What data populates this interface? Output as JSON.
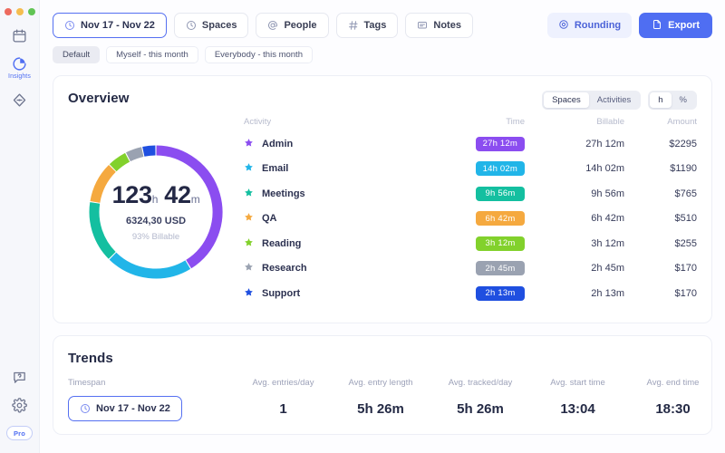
{
  "window": {
    "traffic_lights": [
      {
        "name": "close",
        "color": "#ed6a5e"
      },
      {
        "name": "minimize",
        "color": "#f5bd4f"
      },
      {
        "name": "zoom",
        "color": "#61c454"
      }
    ]
  },
  "sidebar": {
    "items": [
      {
        "name": "calendar",
        "icon": "calendar-icon",
        "label": ""
      },
      {
        "name": "insights",
        "icon": "insights-pie-icon",
        "label": "Insights"
      },
      {
        "name": "integrations",
        "icon": "diamond-icon",
        "label": ""
      }
    ],
    "bottom": [
      {
        "name": "help",
        "icon": "help-chat-icon",
        "label": ""
      },
      {
        "name": "settings",
        "icon": "gear-icon",
        "label": ""
      }
    ],
    "pro_badge": "Pro"
  },
  "toolbar": {
    "buttons": [
      {
        "label": "Nov 17 - Nov 22",
        "icon": "clock-icon",
        "active": true
      },
      {
        "label": "Spaces",
        "icon": "clock-icon",
        "active": false
      },
      {
        "label": "People",
        "icon": "at-icon",
        "active": false
      },
      {
        "label": "Tags",
        "icon": "hash-icon",
        "active": false
      },
      {
        "label": "Notes",
        "icon": "note-icon",
        "active": false
      }
    ],
    "rounding_label": "Rounding",
    "export_label": "Export",
    "accent_color": "#4f6ef2"
  },
  "filters": [
    {
      "label": "Default",
      "selected": true
    },
    {
      "label": "Myself - this month",
      "selected": false
    },
    {
      "label": "Everybody - this month",
      "selected": false
    }
  ],
  "overview": {
    "title": "Overview",
    "view_toggle": [
      {
        "label": "Spaces",
        "on": true
      },
      {
        "label": "Activities",
        "on": false
      }
    ],
    "unit_toggle": [
      {
        "label": "h",
        "on": true
      },
      {
        "label": "%",
        "on": false
      }
    ],
    "donut": {
      "hours": "123",
      "hours_unit": "h",
      "minutes": "42",
      "minutes_unit": "m",
      "amount": "6324,30 USD",
      "billable_note": "93% Billable"
    },
    "columns": {
      "activity": "Activity",
      "time": "Time",
      "billable": "Billable",
      "amount": "Amount"
    },
    "rows": [
      {
        "activity": "Admin",
        "time": "27h 12m",
        "billable": "27h 12m",
        "amount": "$2295",
        "color": "#8b4df0"
      },
      {
        "activity": "Email",
        "time": "14h 02m",
        "billable": "14h 02m",
        "amount": "$1190",
        "color": "#21b5e8"
      },
      {
        "activity": "Meetings",
        "time": "9h 56m",
        "billable": "9h 56m",
        "amount": "$765",
        "color": "#14bfa0"
      },
      {
        "activity": "QA",
        "time": "6h 42m",
        "billable": "6h 42m",
        "amount": "$510",
        "color": "#f5a council"
      },
      {
        "activity": "Reading",
        "time": "3h 12m",
        "billable": "3h 12m",
        "amount": "$255",
        "color": "#82d12c"
      },
      {
        "activity": "Research",
        "time": "2h 45m",
        "billable": "2h 45m",
        "amount": "$170",
        "color": "#9aa2b1"
      },
      {
        "activity": "Support",
        "time": "2h 13m",
        "billable": "2h 13m",
        "amount": "$170",
        "color": "#1f4fe0"
      }
    ]
  },
  "chart_data": {
    "type": "pie",
    "title": "Overview",
    "center_label": "123h 42m",
    "categories": [
      "Admin",
      "Email",
      "Meetings",
      "QA",
      "Reading",
      "Research",
      "Support"
    ],
    "values": [
      27.2,
      14.03,
      9.93,
      6.7,
      3.2,
      2.75,
      2.22
    ],
    "value_labels": [
      "27h 12m",
      "14h 02m",
      "9h 56m",
      "6h 42m",
      "3h 12m",
      "2h 45m",
      "2h 13m"
    ],
    "colors": [
      "#8b4df0",
      "#21b5e8",
      "#14bfa0",
      "#f5a93f",
      "#82d12c",
      "#9aa2b1",
      "#1f4fe0"
    ],
    "legend": "right",
    "grid": false
  },
  "trends": {
    "title": "Trends",
    "columns": [
      "Timespan",
      "Avg. entries/day",
      "Avg. entry length",
      "Avg. tracked/day",
      "Avg. start time",
      "Avg. end time"
    ],
    "timespan": "Nov 17 - Nov 22",
    "values": [
      "1",
      "5h 26m",
      "5h 26m",
      "13:04",
      "18:30"
    ]
  }
}
